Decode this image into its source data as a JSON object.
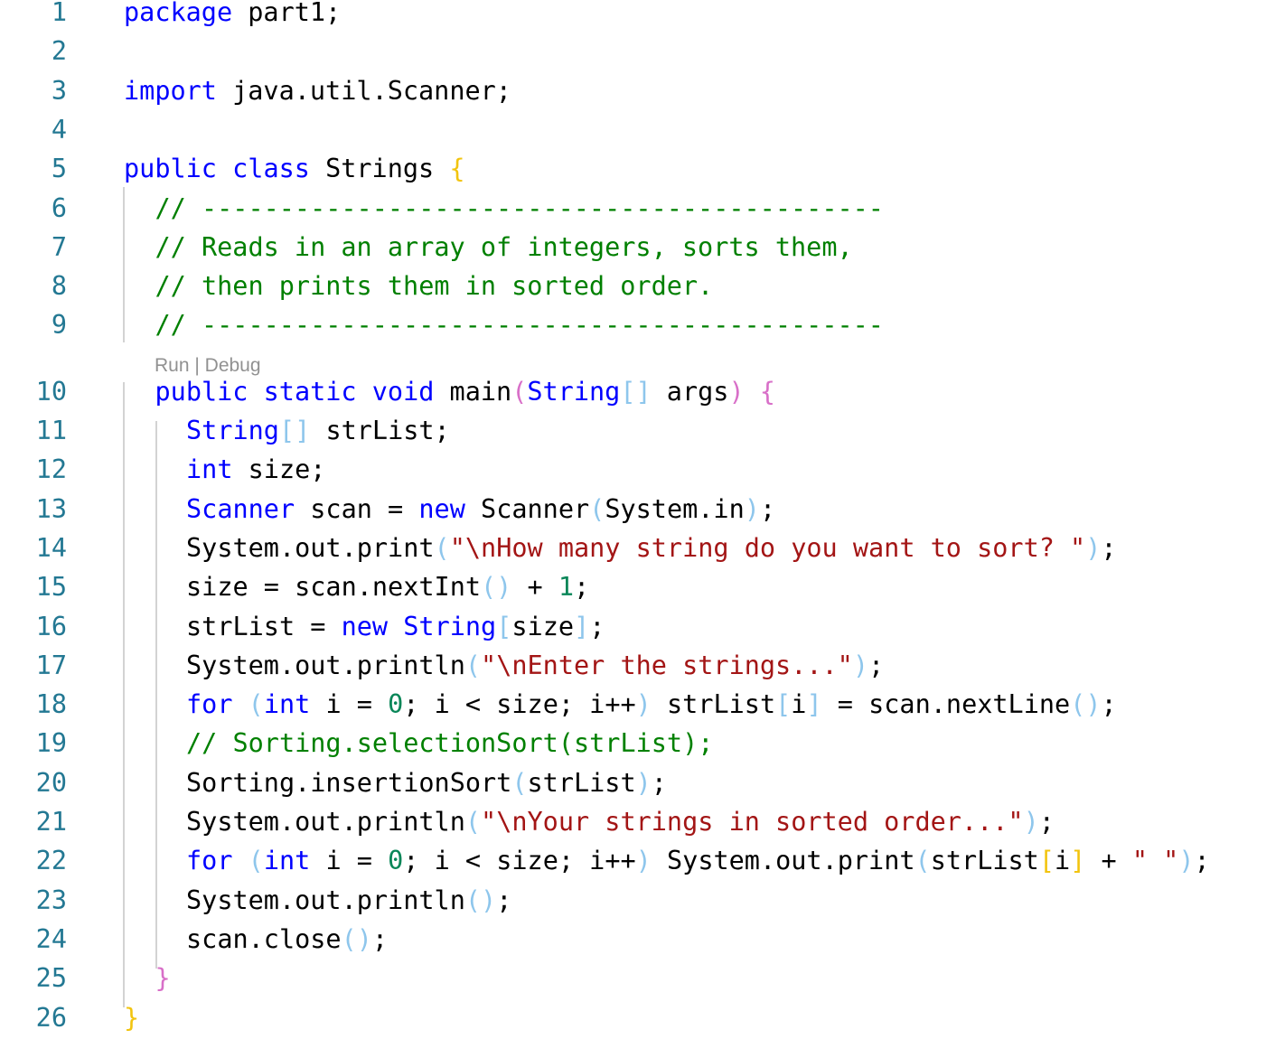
{
  "editor": {
    "codelens": "Run | Debug",
    "colors": {
      "keyword": "#0000ff",
      "type": "#267f99",
      "string": "#a31515",
      "comment": "#008000",
      "number": "#098658",
      "plain": "#000000",
      "bracket_gold": "#f2c40f",
      "bracket_pink": "#d86fc8",
      "bracket_blue": "#8ec6ec",
      "line_number": "#237893",
      "indent_guide": "#d3d3d3"
    },
    "lines": [
      {
        "num": "1",
        "indent": 0,
        "tokens": [
          [
            "kw",
            "package"
          ],
          [
            "p",
            " part1;"
          ]
        ]
      },
      {
        "num": "2",
        "indent": 0,
        "tokens": []
      },
      {
        "num": "3",
        "indent": 0,
        "tokens": [
          [
            "kw",
            "import"
          ],
          [
            "p",
            " java.util.Scanner;"
          ]
        ]
      },
      {
        "num": "4",
        "indent": 0,
        "tokens": []
      },
      {
        "num": "5",
        "indent": 0,
        "tokens": [
          [
            "kw",
            "public"
          ],
          [
            "p",
            " "
          ],
          [
            "kw",
            "class"
          ],
          [
            "p",
            " Strings "
          ],
          [
            "bg",
            "{"
          ]
        ]
      },
      {
        "num": "6",
        "indent": 1,
        "tokens": [
          [
            "cm",
            "// --------------------------------------------"
          ]
        ]
      },
      {
        "num": "7",
        "indent": 1,
        "tokens": [
          [
            "cm",
            "// Reads in an array of integers, sorts them,"
          ]
        ]
      },
      {
        "num": "8",
        "indent": 1,
        "tokens": [
          [
            "cm",
            "// then prints them in sorted order."
          ]
        ]
      },
      {
        "num": "9",
        "indent": 1,
        "tokens": [
          [
            "cm",
            "// --------------------------------------------"
          ]
        ]
      },
      {
        "num": "10",
        "indent": 1,
        "tokens": [
          [
            "kw",
            "public"
          ],
          [
            "p",
            " "
          ],
          [
            "kw",
            "static"
          ],
          [
            "p",
            " "
          ],
          [
            "kw",
            "void"
          ],
          [
            "p",
            " main"
          ],
          [
            "bp",
            "("
          ],
          [
            "kw",
            "String"
          ],
          [
            "bb",
            "[]"
          ],
          [
            "p",
            " args"
          ],
          [
            "bp",
            ")"
          ],
          [
            "p",
            " "
          ],
          [
            "bp",
            "{"
          ]
        ]
      },
      {
        "num": "11",
        "indent": 2,
        "tokens": [
          [
            "kw",
            "String"
          ],
          [
            "bb",
            "[]"
          ],
          [
            "p",
            " strList;"
          ]
        ]
      },
      {
        "num": "12",
        "indent": 2,
        "tokens": [
          [
            "kw",
            "int"
          ],
          [
            "p",
            " size;"
          ]
        ]
      },
      {
        "num": "13",
        "indent": 2,
        "tokens": [
          [
            "kw",
            "Scanner"
          ],
          [
            "p",
            " scan = "
          ],
          [
            "kw",
            "new"
          ],
          [
            "p",
            " Scanner"
          ],
          [
            "bb",
            "("
          ],
          [
            "p",
            "System.in"
          ],
          [
            "bb",
            ")"
          ],
          [
            "p",
            ";"
          ]
        ]
      },
      {
        "num": "14",
        "indent": 2,
        "tokens": [
          [
            "p",
            "System.out.print"
          ],
          [
            "bb",
            "("
          ],
          [
            "st",
            "\"\\nHow many string do you want to sort? \""
          ],
          [
            "bb",
            ")"
          ],
          [
            "p",
            ";"
          ]
        ]
      },
      {
        "num": "15",
        "indent": 2,
        "tokens": [
          [
            "p",
            "size = scan.nextInt"
          ],
          [
            "bb",
            "()"
          ],
          [
            "p",
            " + "
          ],
          [
            "nu",
            "1"
          ],
          [
            "p",
            ";"
          ]
        ]
      },
      {
        "num": "16",
        "indent": 2,
        "tokens": [
          [
            "p",
            "strList = "
          ],
          [
            "kw",
            "new"
          ],
          [
            "p",
            " "
          ],
          [
            "kw",
            "String"
          ],
          [
            "bb",
            "["
          ],
          [
            "p",
            "size"
          ],
          [
            "bb",
            "]"
          ],
          [
            "p",
            ";"
          ]
        ]
      },
      {
        "num": "17",
        "indent": 2,
        "tokens": [
          [
            "p",
            "System.out.println"
          ],
          [
            "bb",
            "("
          ],
          [
            "st",
            "\"\\nEnter the strings...\""
          ],
          [
            "bb",
            ")"
          ],
          [
            "p",
            ";"
          ]
        ]
      },
      {
        "num": "18",
        "indent": 2,
        "tokens": [
          [
            "kw",
            "for"
          ],
          [
            "p",
            " "
          ],
          [
            "bb",
            "("
          ],
          [
            "kw",
            "int"
          ],
          [
            "p",
            " i = "
          ],
          [
            "nu",
            "0"
          ],
          [
            "p",
            "; i < size; i++"
          ],
          [
            "bb",
            ")"
          ],
          [
            "p",
            " strList"
          ],
          [
            "bb",
            "["
          ],
          [
            "p",
            "i"
          ],
          [
            "bb",
            "]"
          ],
          [
            "p",
            " = scan.nextLine"
          ],
          [
            "bb",
            "()"
          ],
          [
            "p",
            ";"
          ]
        ]
      },
      {
        "num": "19",
        "indent": 2,
        "tokens": [
          [
            "cm",
            "// Sorting.selectionSort(strList);"
          ]
        ]
      },
      {
        "num": "20",
        "indent": 2,
        "tokens": [
          [
            "p",
            "Sorting.insertionSort"
          ],
          [
            "bb",
            "("
          ],
          [
            "p",
            "strList"
          ],
          [
            "bb",
            ")"
          ],
          [
            "p",
            ";"
          ]
        ]
      },
      {
        "num": "21",
        "indent": 2,
        "tokens": [
          [
            "p",
            "System.out.println"
          ],
          [
            "bb",
            "("
          ],
          [
            "st",
            "\"\\nYour strings in sorted order...\""
          ],
          [
            "bb",
            ")"
          ],
          [
            "p",
            ";"
          ]
        ]
      },
      {
        "num": "22",
        "indent": 2,
        "tokens": [
          [
            "kw",
            "for"
          ],
          [
            "p",
            " "
          ],
          [
            "bb",
            "("
          ],
          [
            "kw",
            "int"
          ],
          [
            "p",
            " i = "
          ],
          [
            "nu",
            "0"
          ],
          [
            "p",
            "; i < size; i++"
          ],
          [
            "bb",
            ")"
          ],
          [
            "p",
            " System.out.print"
          ],
          [
            "bb",
            "("
          ],
          [
            "p",
            "strList"
          ],
          [
            "bg",
            "["
          ],
          [
            "p",
            "i"
          ],
          [
            "bg",
            "]"
          ],
          [
            "p",
            " + "
          ],
          [
            "st",
            "\" \""
          ],
          [
            "bb",
            ")"
          ],
          [
            "p",
            ";"
          ]
        ]
      },
      {
        "num": "23",
        "indent": 2,
        "tokens": [
          [
            "p",
            "System.out.println"
          ],
          [
            "bb",
            "()"
          ],
          [
            "p",
            ";"
          ]
        ]
      },
      {
        "num": "24",
        "indent": 2,
        "tokens": [
          [
            "p",
            "scan.close"
          ],
          [
            "bb",
            "()"
          ],
          [
            "p",
            ";"
          ]
        ]
      },
      {
        "num": "25",
        "indent": 1,
        "tokens": [
          [
            "bp",
            "}"
          ]
        ]
      },
      {
        "num": "26",
        "indent": 0,
        "tokens": [
          [
            "bg",
            "}"
          ]
        ]
      }
    ]
  }
}
